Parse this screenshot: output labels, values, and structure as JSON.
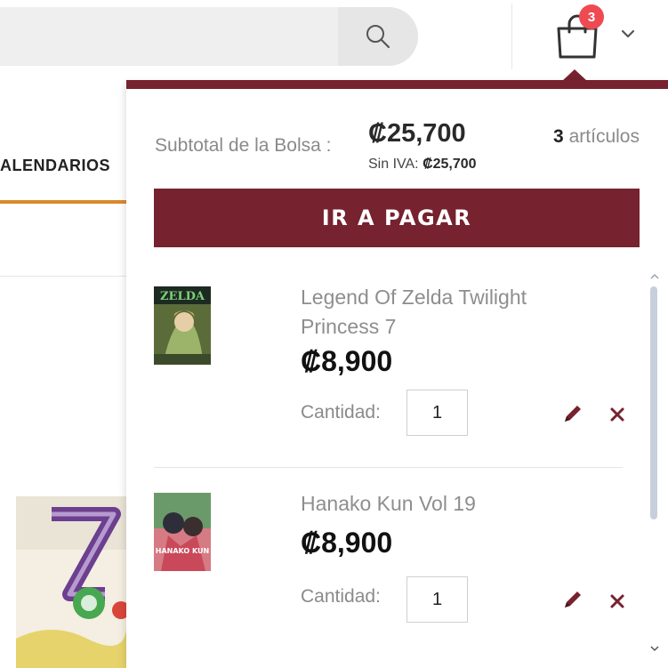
{
  "header": {
    "search_placeholder": "",
    "cart_badge_count": "3",
    "nav_item_label": "ALENDARIOS"
  },
  "mini_cart": {
    "subtotal_label": "Subtotal de la Bolsa :",
    "subtotal_amount": "₡25,700",
    "tax_label": "Sin IVA:",
    "tax_amount": "₡25,700",
    "items_count": "3",
    "items_label": "artículos",
    "checkout_label": "IR A PAGAR",
    "items": [
      {
        "name": "Legend Of Zelda Twilight Princess 7",
        "price": "₡8,900",
        "qty_label": "Cantidad:",
        "qty": "1",
        "thumb_text": "ZELDA"
      },
      {
        "name": "Hanako Kun Vol 19",
        "price": "₡8,900",
        "qty_label": "Cantidad:",
        "qty": "1",
        "thumb_text": "HANAKO KUN"
      }
    ]
  },
  "colors": {
    "brand": "#76222f",
    "badge": "#ef4a52",
    "nav_underline": "#d98a2b"
  },
  "icons": [
    "search-icon",
    "shopping-bag-icon",
    "chevron-down-icon",
    "pencil-icon",
    "close-icon"
  ]
}
